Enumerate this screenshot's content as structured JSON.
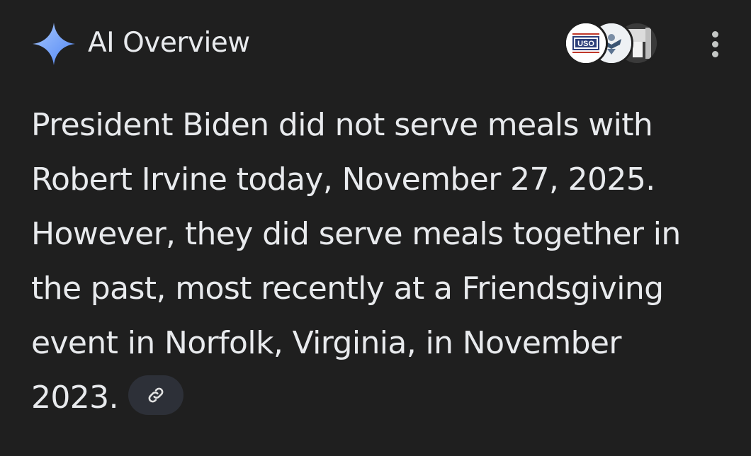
{
  "header": {
    "title": "AI Overview",
    "icon": "sparkle-icon",
    "accent_color": "#8ab4f8"
  },
  "sources": [
    {
      "name": "uso-logo",
      "label": "USO"
    },
    {
      "name": "navy-logo"
    },
    {
      "name": "source-thumbnail"
    }
  ],
  "more_menu": {
    "icon": "more-vert-icon"
  },
  "answer": {
    "lines": [
      "President Biden did not serve meals with",
      "Robert Irvine today, November 27, 2025.",
      "However, they did serve meals together in",
      "the past, most recently at a Friendsgiving",
      "event in Norfolk, Virginia, in November",
      "2023."
    ],
    "link_chip_icon": "link-icon"
  }
}
